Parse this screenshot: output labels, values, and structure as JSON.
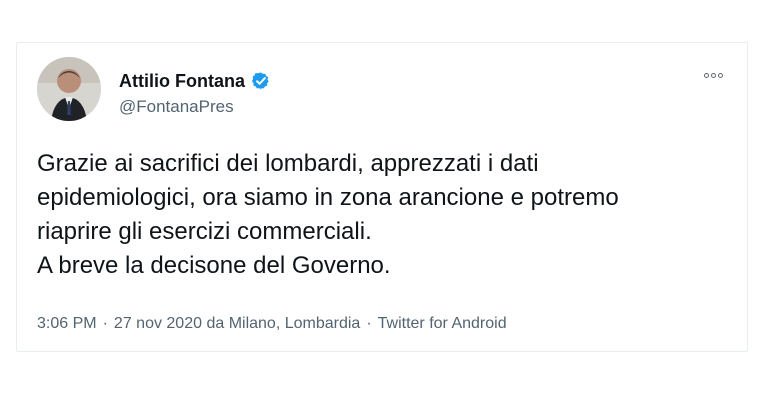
{
  "tweet": {
    "author": {
      "display_name": "Attilio Fontana",
      "handle": "@FontanaPres",
      "verified_icon": "verified-badge-icon",
      "avatar": "profile-photo"
    },
    "menu_icon": "more-options-icon",
    "text": "Grazie ai sacrifici dei lombardi, apprezzati i dati\nepidemiologici, ora siamo in zona arancione e potremo\nriaprire gli esercizi commerciali.\nA breve la decisone del Governo.",
    "meta": {
      "time": "3:06 PM",
      "separator": "·",
      "date_location": "27 nov 2020 da Milano, Lombardia",
      "source": "Twitter for Android"
    },
    "colors": {
      "text_primary": "#0f1419",
      "text_secondary": "#536471",
      "verified_blue": "#1d9bf0",
      "border": "#e8edf1"
    }
  }
}
